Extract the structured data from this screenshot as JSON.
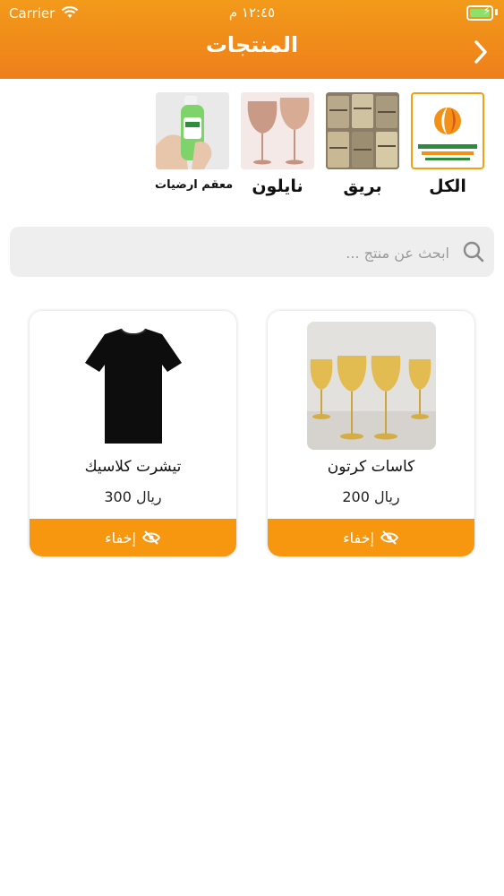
{
  "status_bar": {
    "carrier": "Carrier",
    "time": "١٢:٤٥ م"
  },
  "header": {
    "title": "المنتجات"
  },
  "categories": [
    {
      "label": "الكل"
    },
    {
      "label": "بريق"
    },
    {
      "label": "نايلون"
    },
    {
      "label": "معقم ارضيات"
    }
  ],
  "search": {
    "placeholder": "ابحث عن منتج ..."
  },
  "products": [
    {
      "name": "كاسات كرتون",
      "price": "200 ريال",
      "hide_label": "إخفاء"
    },
    {
      "name": "تيشرت كلاسيك",
      "price": "300 ريال",
      "hide_label": "إخفاء"
    }
  ],
  "colors": {
    "header_orange": "#f08a1a",
    "button_orange": "#f7960f",
    "selected_border": "#f5a011"
  }
}
